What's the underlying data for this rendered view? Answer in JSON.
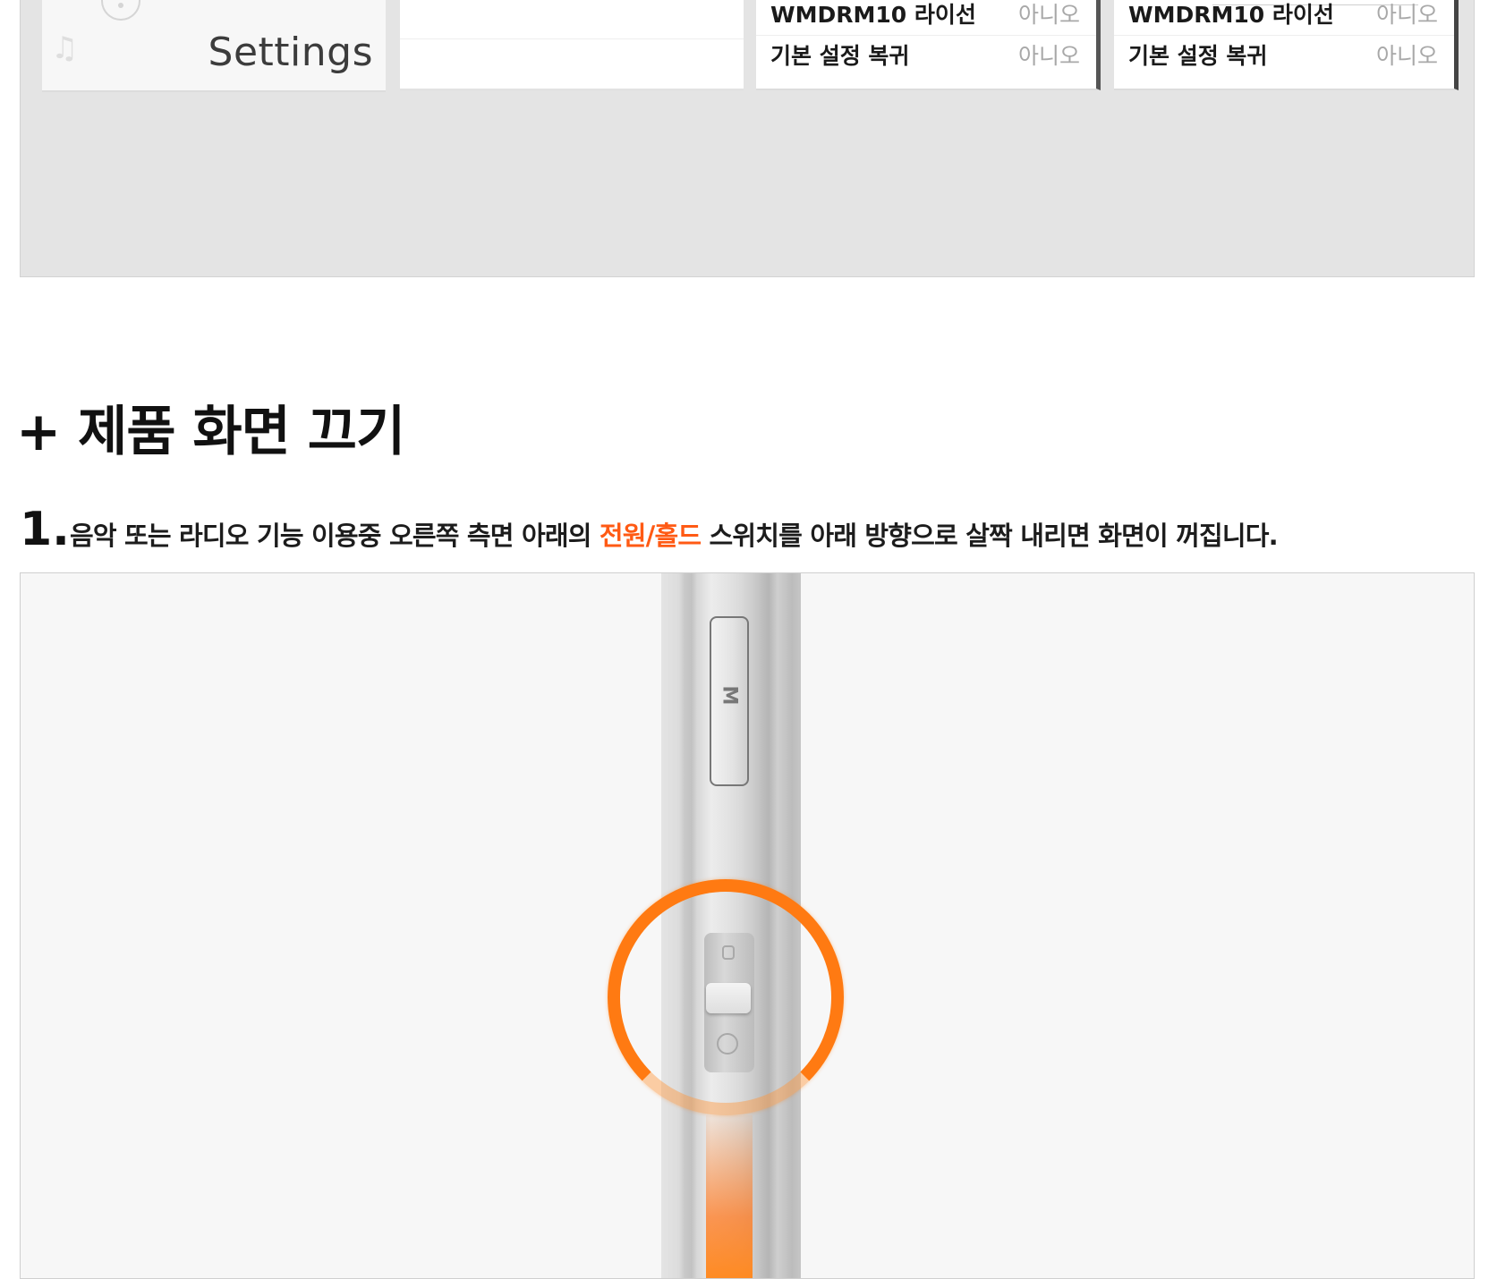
{
  "top_screenshot": {
    "menu_label": "Settings",
    "list_left": [
      {
        "name": "WMDRM10 라이선",
        "value": "아니오"
      },
      {
        "name": "기본 설정 복귀",
        "value": "아니오"
      }
    ],
    "list_right": [
      {
        "name": "WMDRM10 라이선",
        "value": "아니오"
      },
      {
        "name": "기본 설정 복귀",
        "value": "아니오"
      }
    ]
  },
  "section": {
    "title": "+ 제품 화면 끄기"
  },
  "step1": {
    "number": "1.",
    "text_before": "음악 또는 라디오 기능 이용중 오른쪽 측면 아래의 ",
    "highlight": "전원/홀드",
    "text_after": " 스위치를 아래 방향으로 살짝 내리면 화면이 꺼집니다."
  },
  "device": {
    "button_label": "M"
  },
  "colors": {
    "highlight": "#ff5a14",
    "ring": "#ff7a12",
    "panel_bg": "#e4e4e4"
  }
}
